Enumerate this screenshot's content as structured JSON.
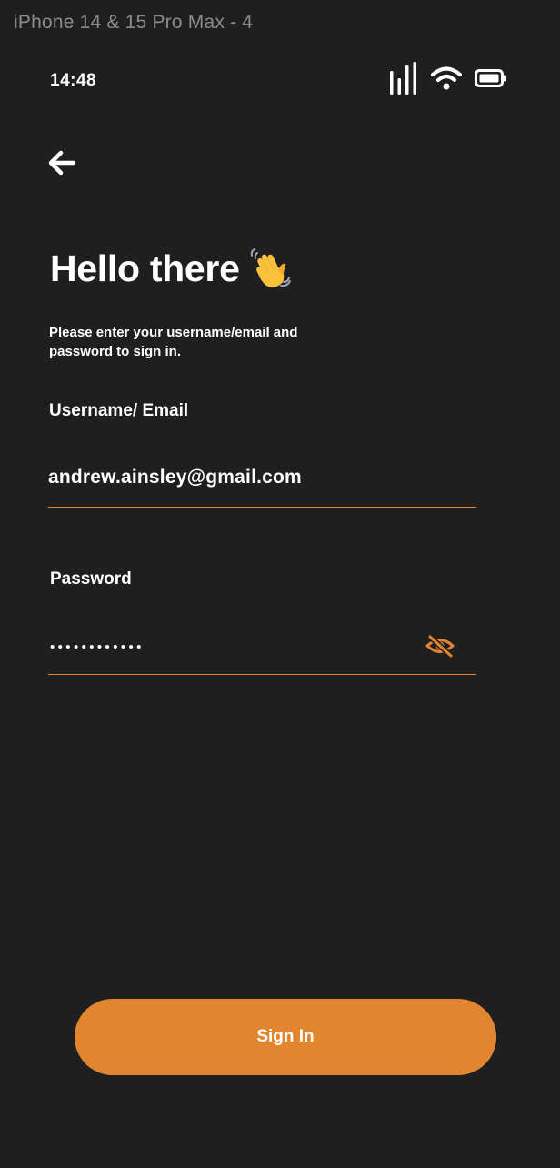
{
  "frame": {
    "label": "iPhone 14 & 15 Pro Max - 4"
  },
  "status_bar": {
    "time": "14:48",
    "icons": [
      "signal-icon",
      "wifi-icon",
      "battery-icon"
    ]
  },
  "nav": {
    "back_icon": "arrow-left-icon"
  },
  "header": {
    "title": "Hello there",
    "title_icon": "waving-hand-icon",
    "subtitle": "Please enter your username/email and password to sign in."
  },
  "form": {
    "username": {
      "label": "Username/ Email",
      "value": "andrew.ainsley@gmail.com"
    },
    "password": {
      "label": "Password",
      "masked_value": "••••••••••••",
      "toggle_icon": "eye-off-icon"
    }
  },
  "actions": {
    "sign_in_label": "Sign In"
  },
  "colors": {
    "background": "#1f1f1f",
    "accent": "#e2852f",
    "text": "#ffffff",
    "frame_label": "#8c8c8c"
  }
}
